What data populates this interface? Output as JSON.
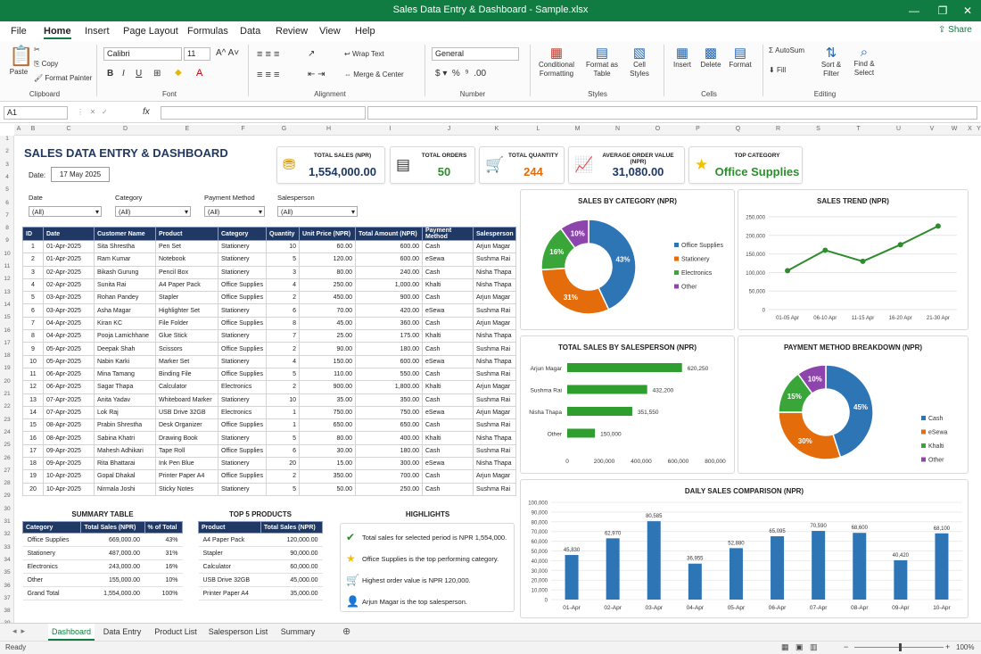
{
  "window": {
    "title": "Sales Data Entry & Dashboard - Sample.xlsx",
    "share": "Share"
  },
  "menu": [
    "File",
    "Home",
    "Insert",
    "Page Layout",
    "Formulas",
    "Data",
    "Review",
    "View",
    "Help"
  ],
  "ribbon": {
    "clipboard": {
      "paste": "Paste",
      "cut": "Cut",
      "copy": "Copy",
      "format_painter": "Format Painter",
      "group": "Clipboard"
    },
    "font": {
      "name": "Calibri",
      "size": "11",
      "group": "Font"
    },
    "alignment": {
      "wrap": "Wrap Text",
      "merge": "Merge & Center",
      "group": "Alignment"
    },
    "number": {
      "format": "General",
      "group": "Number"
    },
    "styles": {
      "conditional": "Conditional Formatting",
      "format_table": "Format as Table",
      "cell_styles": "Cell Styles",
      "group": "Styles"
    },
    "cells": {
      "insert": "Insert",
      "delete": "Delete",
      "format": "Format",
      "group": "Cells"
    },
    "editing": {
      "sum": "AutoSum",
      "fill": "Fill",
      "sort": "Sort & Filter",
      "find": "Find & Select",
      "group": "Editing"
    }
  },
  "formula": {
    "namebox": "A1",
    "fx": "fx",
    "value": ""
  },
  "columns": [
    "A",
    "B",
    "C",
    "D",
    "E",
    "F",
    "G",
    "H",
    "I",
    "J",
    "K",
    "L",
    "M",
    "N",
    "O",
    "P",
    "Q",
    "R",
    "S",
    "T",
    "U",
    "V",
    "W",
    "X",
    "Y"
  ],
  "rows": [
    "1",
    "2",
    "3",
    "4",
    "5",
    "6",
    "7",
    "8",
    "9",
    "10",
    "11",
    "12",
    "13",
    "14",
    "15",
    "16",
    "17",
    "18",
    "19",
    "20",
    "21",
    "22",
    "23",
    "24",
    "25",
    "26",
    "27",
    "28",
    "29",
    "30",
    "31",
    "32",
    "33",
    "34",
    "35",
    "36",
    "37",
    "38",
    "39",
    "40"
  ],
  "dashboard": {
    "title": "SALES DATA ENTRY & DASHBOARD",
    "date_label": "Date:",
    "date_value": "17 May 2025",
    "kpis": [
      {
        "label": "TOTAL SALES (NPR)",
        "value": "1,554,000.00",
        "color": "#1f3864",
        "icon": "coins-icon"
      },
      {
        "label": "TOTAL ORDERS",
        "value": "50",
        "color": "#2e8b2e",
        "icon": "clipboard-icon"
      },
      {
        "label": "TOTAL QUANTITY",
        "value": "244",
        "color": "#e46c0a",
        "icon": "cart-icon"
      },
      {
        "label": "AVERAGE ORDER VALUE (NPR)",
        "value": "31,080.00",
        "color": "#1f3864",
        "icon": "trend-icon"
      },
      {
        "label": "TOP CATEGORY",
        "value": "Office Supplies",
        "color": "#2e8b2e",
        "icon": "star-icon"
      }
    ],
    "filters": [
      {
        "label": "Date",
        "value": "(All)"
      },
      {
        "label": "Category",
        "value": "(All)"
      },
      {
        "label": "Payment Method",
        "value": "(All)"
      },
      {
        "label": "Salesperson",
        "value": "(All)"
      }
    ]
  },
  "table": {
    "headers": [
      "ID",
      "Date",
      "Customer Name",
      "Product",
      "Category",
      "Quantity",
      "Unit Price (NPR)",
      "Total Amount (NPR)",
      "Payment Method",
      "Salesperson"
    ],
    "rows": [
      [
        "1",
        "01-Apr-2025",
        "Sita Shrestha",
        "Pen Set",
        "Stationery",
        "10",
        "60.00",
        "600.00",
        "Cash",
        "Arjun Magar"
      ],
      [
        "2",
        "01-Apr-2025",
        "Ram Kumar",
        "Notebook",
        "Stationery",
        "5",
        "120.00",
        "600.00",
        "eSewa",
        "Sushma Rai"
      ],
      [
        "3",
        "02-Apr-2025",
        "Bikash Gurung",
        "Pencil Box",
        "Stationery",
        "3",
        "80.00",
        "240.00",
        "Cash",
        "Nisha Thapa"
      ],
      [
        "4",
        "02-Apr-2025",
        "Sunita Rai",
        "A4 Paper Pack",
        "Office Supplies",
        "4",
        "250.00",
        "1,000.00",
        "Khalti",
        "Nisha Thapa"
      ],
      [
        "5",
        "03-Apr-2025",
        "Rohan Pandey",
        "Stapler",
        "Office Supplies",
        "2",
        "450.00",
        "900.00",
        "Cash",
        "Arjun Magar"
      ],
      [
        "6",
        "03-Apr-2025",
        "Asha Magar",
        "Highlighter Set",
        "Stationery",
        "6",
        "70.00",
        "420.00",
        "eSewa",
        "Sushma Rai"
      ],
      [
        "7",
        "04-Apr-2025",
        "Kiran KC",
        "File Folder",
        "Office Supplies",
        "8",
        "45.00",
        "360.00",
        "Cash",
        "Arjun Magar"
      ],
      [
        "8",
        "04-Apr-2025",
        "Pooja Lamichhane",
        "Glue Stick",
        "Stationery",
        "7",
        "25.00",
        "175.00",
        "Khalti",
        "Nisha Thapa"
      ],
      [
        "9",
        "05-Apr-2025",
        "Deepak Shah",
        "Scissors",
        "Office Supplies",
        "2",
        "90.00",
        "180.00",
        "Cash",
        "Sushma Rai"
      ],
      [
        "10",
        "05-Apr-2025",
        "Nabin Karki",
        "Marker Set",
        "Stationery",
        "4",
        "150.00",
        "600.00",
        "eSewa",
        "Nisha Thapa"
      ],
      [
        "11",
        "06-Apr-2025",
        "Mina Tamang",
        "Binding File",
        "Office Supplies",
        "5",
        "110.00",
        "550.00",
        "Cash",
        "Sushma Rai"
      ],
      [
        "12",
        "06-Apr-2025",
        "Sagar Thapa",
        "Calculator",
        "Electronics",
        "2",
        "900.00",
        "1,800.00",
        "Khalti",
        "Arjun Magar"
      ],
      [
        "13",
        "07-Apr-2025",
        "Anita Yadav",
        "Whiteboard Marker",
        "Stationery",
        "10",
        "35.00",
        "350.00",
        "Cash",
        "Sushma Rai"
      ],
      [
        "14",
        "07-Apr-2025",
        "Lok Raj",
        "USB Drive 32GB",
        "Electronics",
        "1",
        "750.00",
        "750.00",
        "eSewa",
        "Arjun Magar"
      ],
      [
        "15",
        "08-Apr-2025",
        "Prabin Shrestha",
        "Desk Organizer",
        "Office Supplies",
        "1",
        "650.00",
        "650.00",
        "Cash",
        "Sushma Rai"
      ],
      [
        "16",
        "08-Apr-2025",
        "Sabina Khatri",
        "Drawing Book",
        "Stationery",
        "5",
        "80.00",
        "400.00",
        "Khalti",
        "Nisha Thapa"
      ],
      [
        "17",
        "09-Apr-2025",
        "Mahesh Adhikari",
        "Tape Roll",
        "Office Supplies",
        "6",
        "30.00",
        "180.00",
        "Cash",
        "Sushma Rai"
      ],
      [
        "18",
        "09-Apr-2025",
        "Rita Bhattarai",
        "Ink Pen Blue",
        "Stationery",
        "20",
        "15.00",
        "300.00",
        "eSewa",
        "Nisha Thapa"
      ],
      [
        "19",
        "10-Apr-2025",
        "Gopal Dhakal",
        "Printer Paper A4",
        "Office Supplies",
        "2",
        "350.00",
        "700.00",
        "Cash",
        "Arjun Magar"
      ],
      [
        "20",
        "10-Apr-2025",
        "Nirmala Joshi",
        "Sticky Notes",
        "Stationery",
        "5",
        "50.00",
        "250.00",
        "Cash",
        "Sushma Rai"
      ]
    ]
  },
  "summary": {
    "title": "SUMMARY TABLE",
    "headers": [
      "Category",
      "Total Sales (NPR)",
      "% of Total"
    ],
    "rows": [
      [
        "Office Supplies",
        "669,000.00",
        "43%"
      ],
      [
        "Stationery",
        "487,000.00",
        "31%"
      ],
      [
        "Electronics",
        "243,000.00",
        "16%"
      ],
      [
        "Other",
        "155,000.00",
        "10%"
      ],
      [
        "Grand Total",
        "1,554,000.00",
        "100%"
      ]
    ]
  },
  "top5": {
    "title": "TOP 5 PRODUCTS",
    "headers": [
      "Product",
      "Total Sales (NPR)"
    ],
    "rows": [
      [
        "A4 Paper Pack",
        "120,000.00"
      ],
      [
        "Stapler",
        "90,000.00"
      ],
      [
        "Calculator",
        "60,000.00"
      ],
      [
        "USB Drive 32GB",
        "45,000.00"
      ],
      [
        "Printer Paper A4",
        "35,000.00"
      ]
    ]
  },
  "highlights": {
    "title": "HIGHLIGHTS",
    "items": [
      {
        "icon": "check-icon",
        "text": "Total sales for selected period is NPR 1,554,000."
      },
      {
        "icon": "star-icon",
        "text": "Office Supplies is the top performing category."
      },
      {
        "icon": "cart-icon",
        "text": "Highest order value is NPR  120,000."
      },
      {
        "icon": "person-icon",
        "text": "Arjun Magar is the top salesperson."
      }
    ]
  },
  "chart_data": [
    {
      "type": "pie",
      "title": "SALES BY CATEGORY (NPR)",
      "categories": [
        "Office Supplies",
        "Stationery",
        "Electronics",
        "Other"
      ],
      "values": [
        43,
        31,
        16,
        10
      ],
      "labels": [
        "43%",
        "31%",
        "16%",
        "10%"
      ],
      "colors": [
        "#2e75b6",
        "#e46c0a",
        "#3aa63a",
        "#8e44ad"
      ],
      "legend": "right"
    },
    {
      "type": "line",
      "title": "SALES TREND (NPR)",
      "categories": [
        "01-05 Apr",
        "06-10 Apr",
        "11-15 Apr",
        "16-20 Apr",
        "21-30 Apr"
      ],
      "values": [
        105000,
        160000,
        130000,
        175000,
        225000
      ],
      "ylim": [
        0,
        250000
      ],
      "yticks": [
        "0",
        "50,000",
        "100,000",
        "150,000",
        "200,000",
        "250,000"
      ],
      "color": "#2e8b2e",
      "grid": true
    },
    {
      "type": "bar",
      "orientation": "horizontal",
      "title": "TOTAL SALES BY SALESPERSON (NPR)",
      "categories": [
        "Arjun Magar",
        "Sushma Rai",
        "Nisha Thapa",
        "Other"
      ],
      "values": [
        620250,
        432200,
        351550,
        150000
      ],
      "labels": [
        "620,250",
        "432,200",
        "351,550",
        "150,000"
      ],
      "xlim": [
        0,
        800000
      ],
      "xticks": [
        "0",
        "200,000",
        "400,000",
        "600,000",
        "800,000"
      ],
      "color": "#2e9e2e"
    },
    {
      "type": "pie",
      "title": "PAYMENT METHOD BREAKDOWN (NPR)",
      "categories": [
        "Cash",
        "eSewa",
        "Khalti",
        "Other"
      ],
      "values": [
        45,
        30,
        15,
        10
      ],
      "labels": [
        "45%",
        "30%",
        "15%",
        "10%"
      ],
      "colors": [
        "#2e75b6",
        "#e46c0a",
        "#3aa63a",
        "#8e44ad"
      ],
      "legend": "right"
    },
    {
      "type": "bar",
      "title": "DAILY SALES COMPARISON (NPR)",
      "categories": [
        "01-Apr",
        "02-Apr",
        "03-Apr",
        "04-Apr",
        "05-Apr",
        "06-Apr",
        "07-Apr",
        "08-Apr",
        "09-Apr",
        "10-Apr"
      ],
      "values": [
        45830,
        62970,
        80585,
        36955,
        52880,
        65095,
        70590,
        68600,
        40420,
        68100
      ],
      "labels": [
        "45,830",
        "62,970",
        "80,585",
        "36,955",
        "52,880",
        "65,095",
        "70,590",
        "68,600",
        "40,420",
        "68,100"
      ],
      "ylim": [
        0,
        100000
      ],
      "yticks": [
        "0",
        "10,000",
        "20,000",
        "30,000",
        "40,000",
        "50,000",
        "60,000",
        "70,000",
        "80,000",
        "90,000",
        "100,000"
      ],
      "color": "#2e75b6",
      "grid": true
    }
  ],
  "sheets": [
    "Dashboard",
    "Data Entry",
    "Product List",
    "Salesperson List",
    "Summary"
  ],
  "status": {
    "ready": "Ready",
    "zoom": "100%"
  }
}
